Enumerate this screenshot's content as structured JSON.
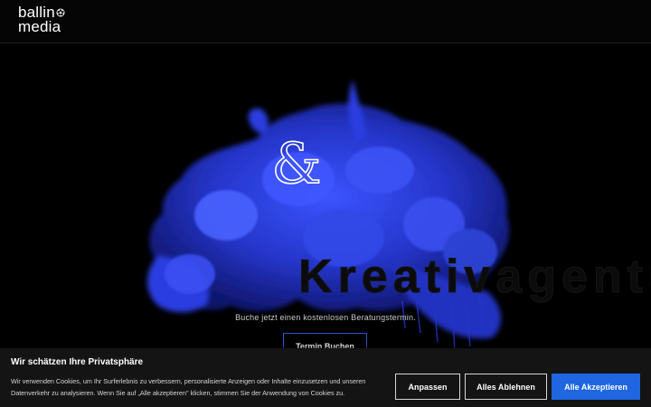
{
  "header": {
    "logo_line1": "ballin",
    "logo_line2": "media"
  },
  "hero": {
    "symbol": "&",
    "background_word": "Kreativagentur",
    "tagline": "Buche jetzt einen kostenlosen Beratungstermin.",
    "cta_label": "Termin Buchen"
  },
  "cookie_banner": {
    "title": "Wir schätzen Ihre Privatsphäre",
    "text": "Wir verwenden Cookies, um Ihr Surferlebnis zu verbessern, personalisierte Anzeigen oder Inhalte einzusetzen und unseren Datenverkehr zu analysieren. Wenn Sie auf „Alle akzeptieren\" klicken, stimmen Sie der Anwendung von Cookies zu.",
    "customize_label": "Anpassen",
    "reject_label": "Alles Ablehnen",
    "accept_label": "Alle Akzeptieren"
  },
  "colors": {
    "accent": "#1f66e0",
    "smoke": "#2a3ee0",
    "cta_border": "#2f54c7"
  }
}
